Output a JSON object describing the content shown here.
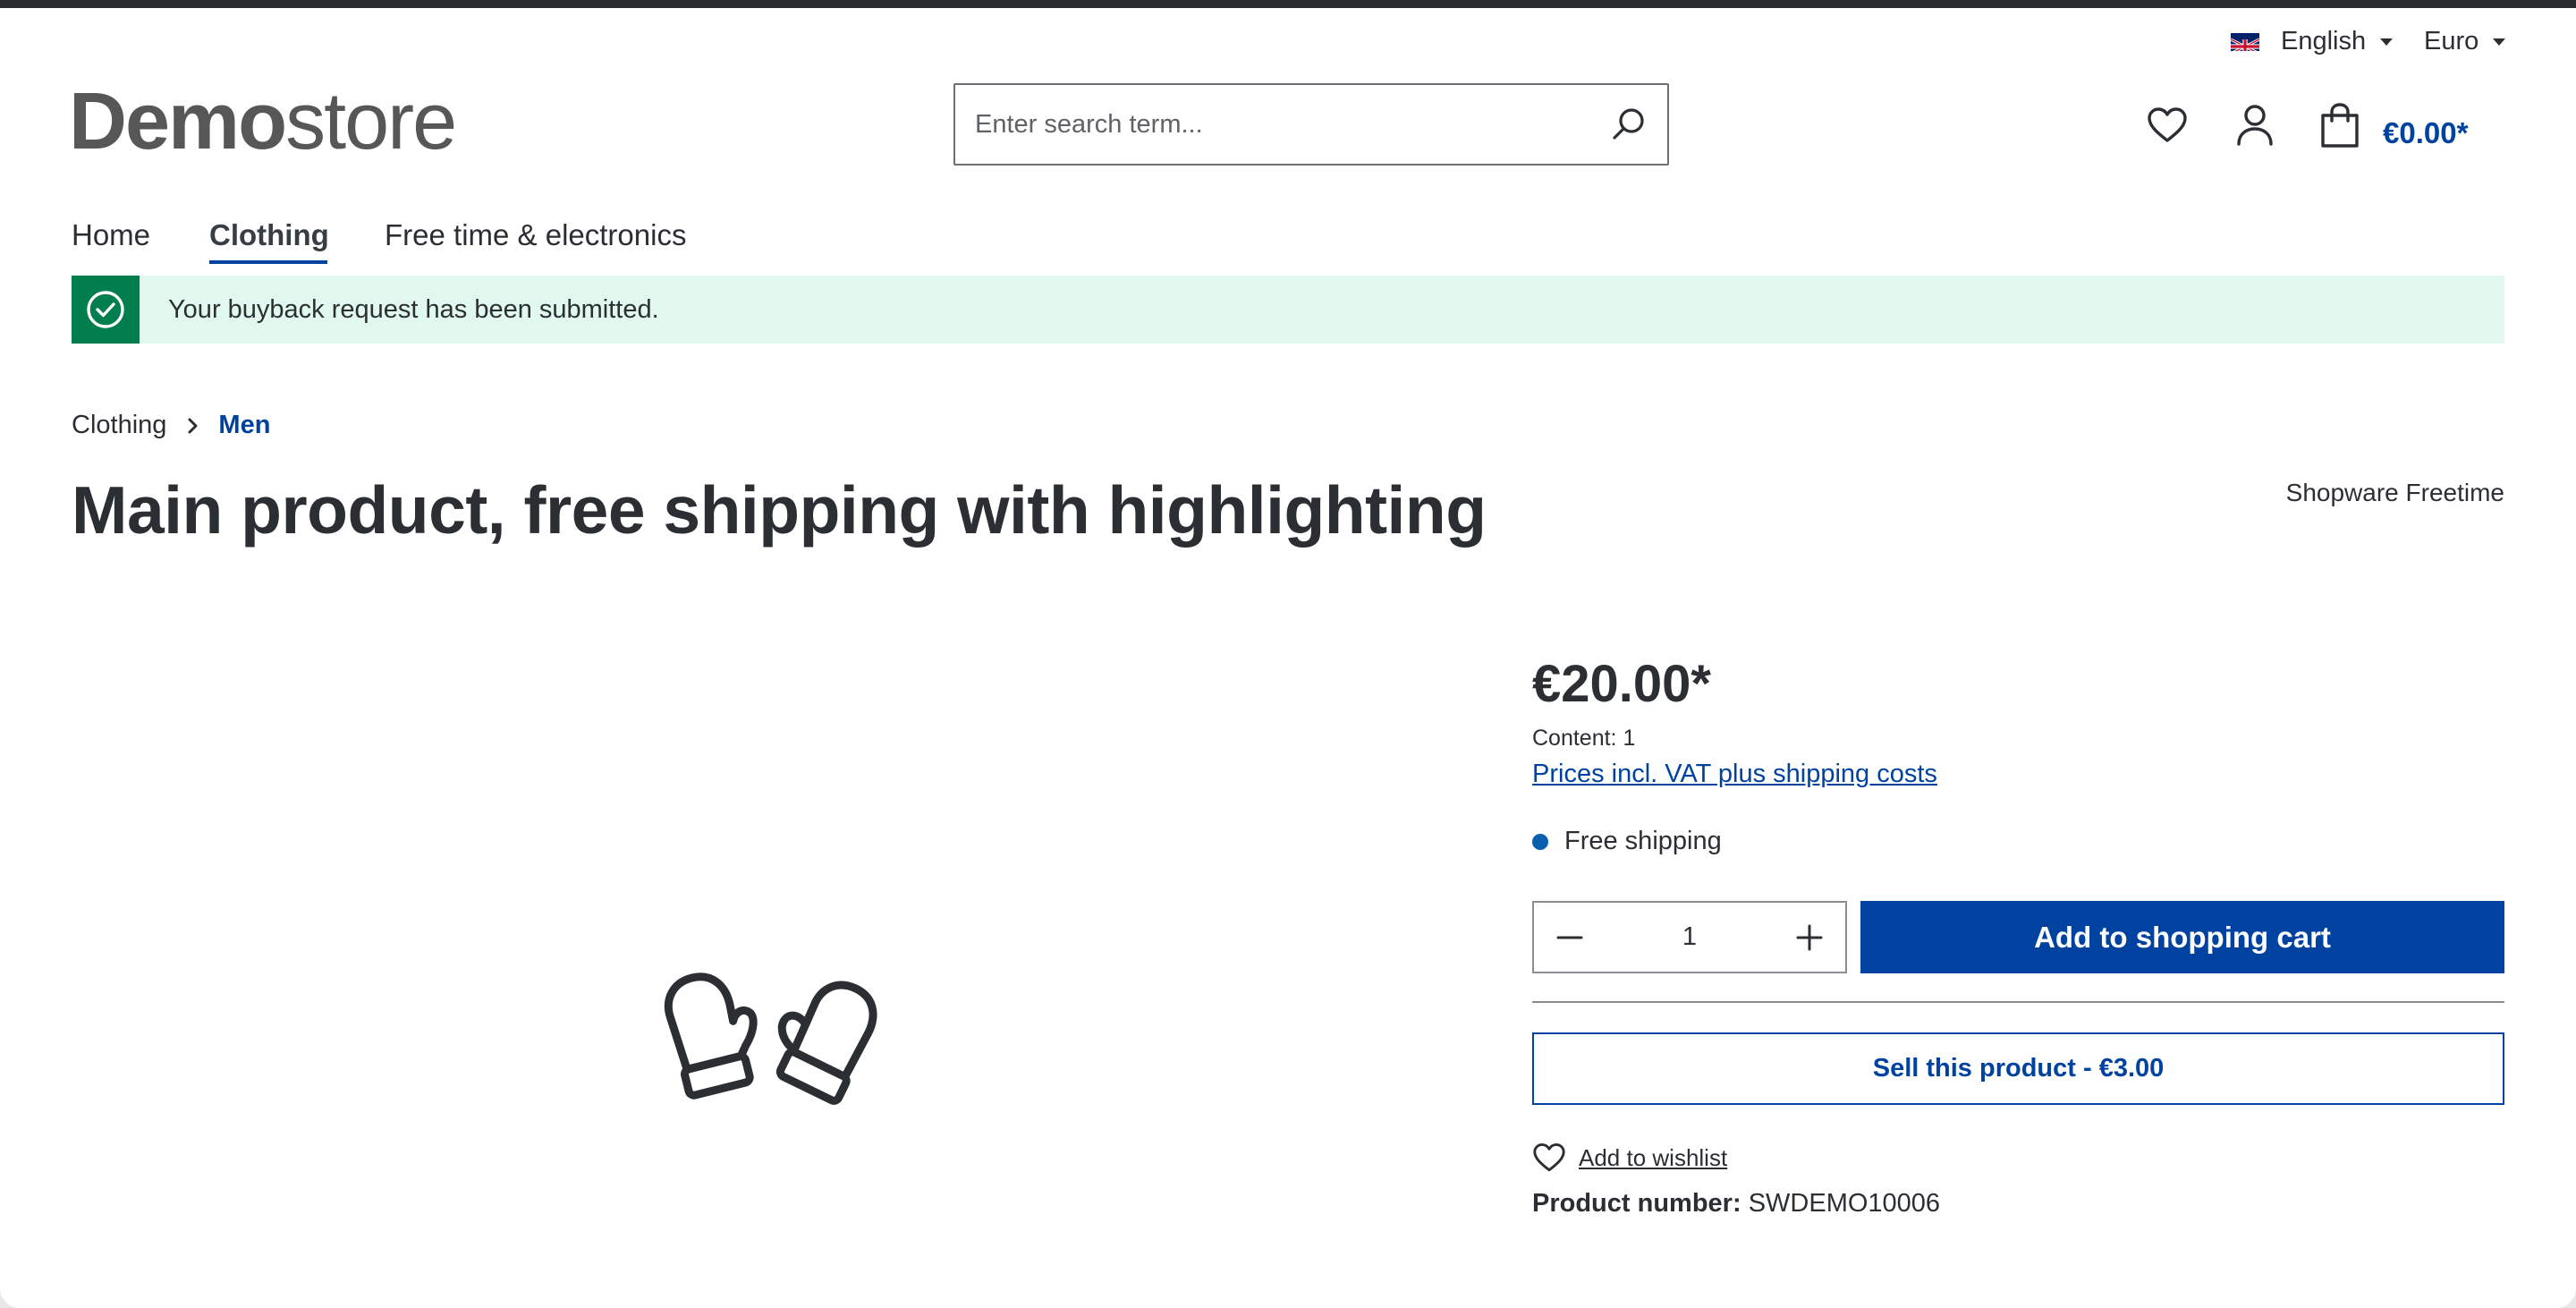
{
  "header": {
    "language": "English",
    "currency": "Euro",
    "logo_bold": "Demo",
    "logo_light": "store",
    "search_placeholder": "Enter search term...",
    "cart_total": "€0.00*"
  },
  "nav": {
    "items": [
      {
        "label": "Home",
        "active": false
      },
      {
        "label": "Clothing",
        "active": true
      },
      {
        "label": "Free time & electronics",
        "active": false
      }
    ]
  },
  "alert": {
    "message": "Your buyback request has been submitted.",
    "type": "success"
  },
  "breadcrumb": [
    {
      "label": "Clothing"
    },
    {
      "label": "Men"
    }
  ],
  "product": {
    "title": "Main product, free shipping with highlighting",
    "manufacturer": "Shopware Freetime",
    "image_icon": "mittens-icon",
    "price": "€20.00*",
    "content": "Content: 1",
    "vat_link": "Prices incl. VAT plus shipping costs",
    "shipping": "Free shipping",
    "quantity": "1",
    "add_to_cart_label": "Add to shopping cart",
    "sell_label": "Sell this product - €3.00",
    "wishlist_label": "Add to wishlist",
    "product_number_label": "Product number:",
    "product_number": "SWDEMO10006"
  },
  "colors": {
    "accent": "#0042a0",
    "success": "#007e4e",
    "success_bg": "#e0f8ee",
    "text": "#2b2f33"
  }
}
